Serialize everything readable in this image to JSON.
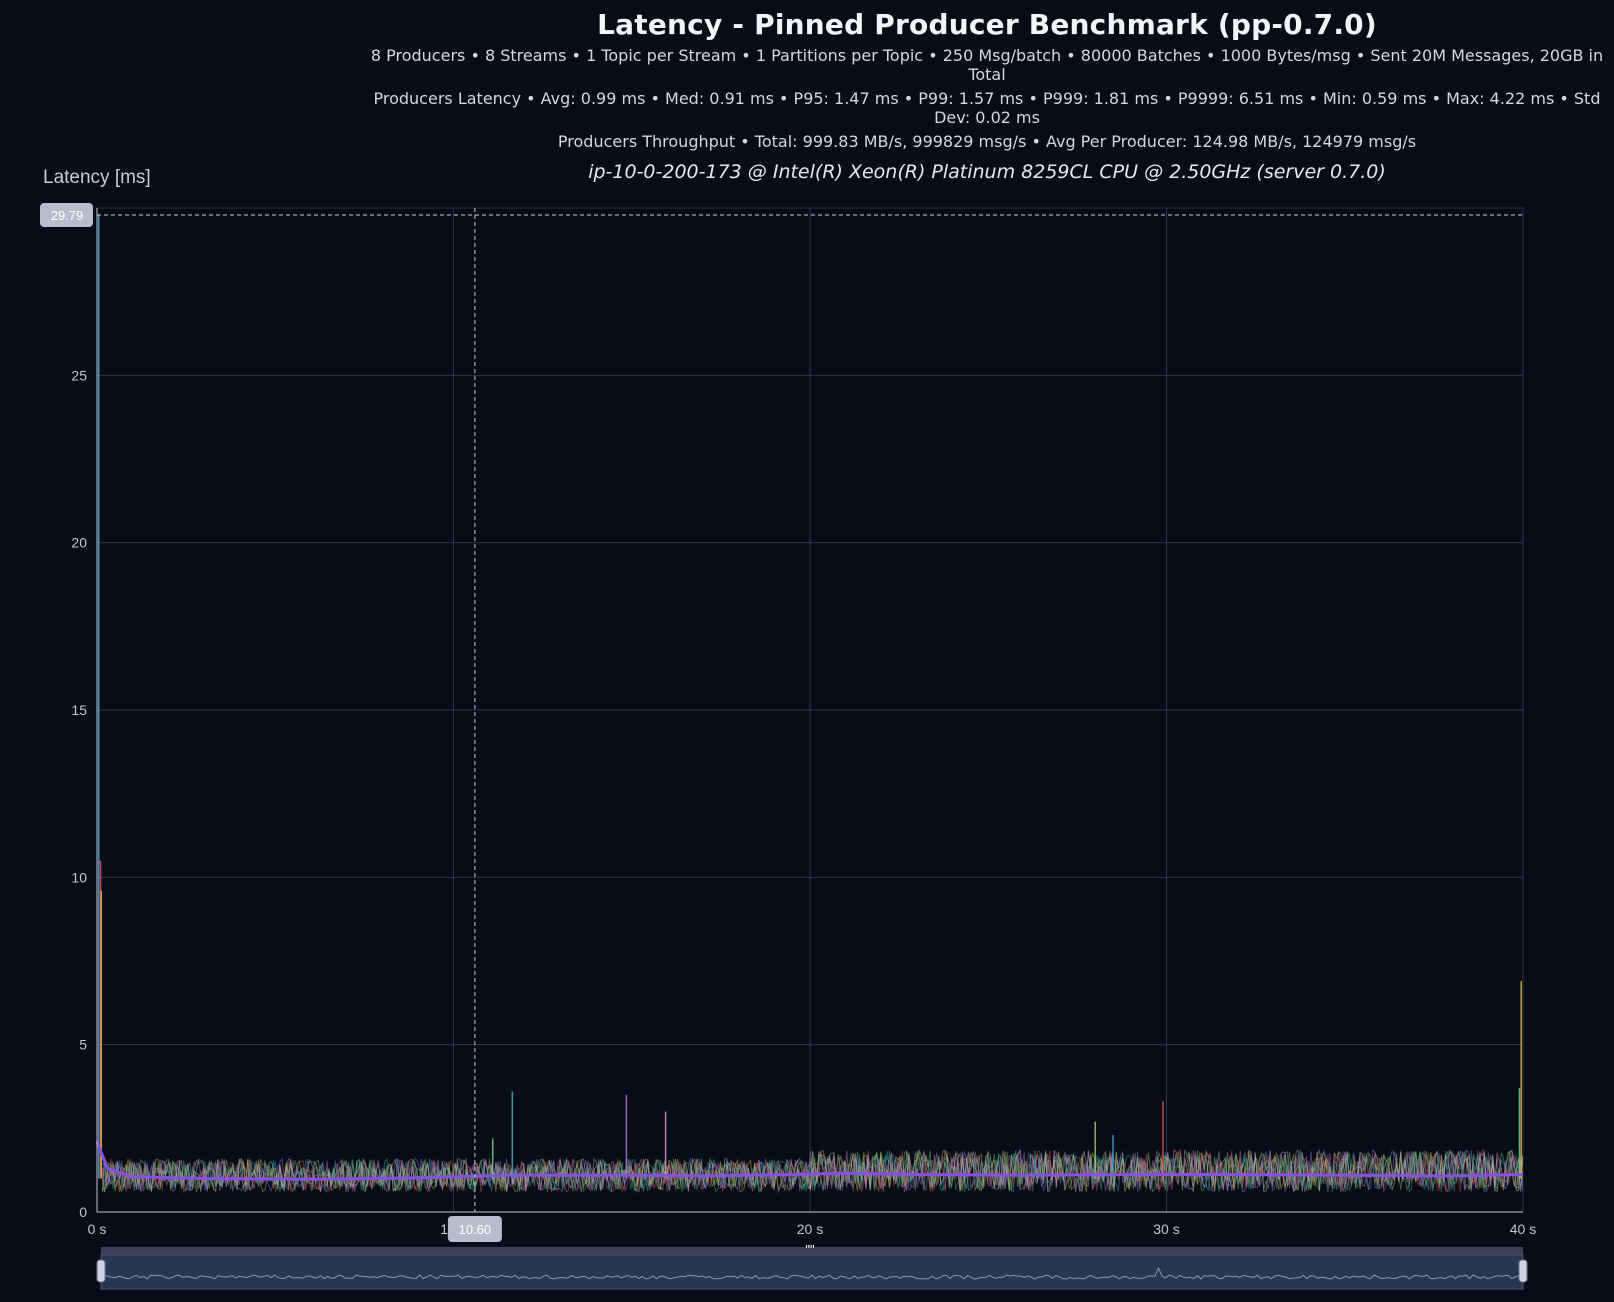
{
  "header": {
    "title": "Latency - Pinned Producer Benchmark (pp-0.7.0)",
    "line1": "8 Producers • 8 Streams • 1 Topic per Stream • 1 Partitions per Topic • 250 Msg/batch • 80000 Batches • 1000 Bytes/msg • Sent 20M Messages, 20GB in Total",
    "line2": "Producers Latency • Avg: 0.99 ms • Med: 0.91 ms • P95: 1.47 ms • P99: 1.57 ms • P999: 1.81 ms • P9999: 6.51 ms • Min: 0.59 ms • Max: 4.22 ms • Std Dev: 0.02 ms",
    "line3": "Producers Throughput • Total: 999.83 MB/s, 999829 msg/s • Avg Per Producer: 124.98 MB/s, 124979 msg/s",
    "host": "ip-10-0-200-173 @ Intel(R) Xeon(R) Platinum 8259CL CPU @ 2.50GHz (server 0.7.0)"
  },
  "chart_data": {
    "type": "line",
    "ylabel": "Latency [ms]",
    "xlim": [
      0,
      40
    ],
    "ylim": [
      0,
      30
    ],
    "x_ticks": [
      {
        "value": 0,
        "label": "0 s"
      },
      {
        "value": 10,
        "label": "10 s"
      },
      {
        "value": 20,
        "label": "20 s"
      },
      {
        "value": 30,
        "label": "30 s"
      },
      {
        "value": 40,
        "label": "40 s"
      }
    ],
    "y_ticks": [
      0,
      5,
      10,
      15,
      20,
      25
    ],
    "grid": true,
    "crosshair": {
      "x": 10.6,
      "y": 29.79,
      "x_label": "10.60",
      "y_label": "29.79"
    },
    "series_colors": [
      "#4fa3d9",
      "#d9574f",
      "#e6b84f",
      "#6fcf8f",
      "#3fb6b0",
      "#b27ad9",
      "#e08ac7",
      "#9ad06f"
    ],
    "average_color": "#8a4fe0",
    "producer_band": {
      "low": 0.6,
      "high": 1.6
    },
    "average_latency": [
      [
        0,
        2.1
      ],
      [
        0.3,
        1.3
      ],
      [
        1,
        1.05
      ],
      [
        3,
        1.0
      ],
      [
        6,
        0.98
      ],
      [
        9,
        1.02
      ],
      [
        11.5,
        1.1
      ],
      [
        14.8,
        1.1
      ],
      [
        17,
        1.08
      ],
      [
        19.5,
        1.12
      ],
      [
        21,
        1.16
      ],
      [
        23,
        1.12
      ],
      [
        26,
        1.1
      ],
      [
        29,
        1.12
      ],
      [
        32,
        1.12
      ],
      [
        35,
        1.1
      ],
      [
        38,
        1.08
      ],
      [
        40,
        1.12
      ]
    ],
    "spikes": [
      [
        0.05,
        29.79
      ],
      [
        0.1,
        10.5
      ],
      [
        0.12,
        9.6
      ],
      [
        11.1,
        2.2
      ],
      [
        11.65,
        3.6
      ],
      [
        14.85,
        3.5
      ],
      [
        15.95,
        3.0
      ],
      [
        28.0,
        2.7
      ],
      [
        28.5,
        2.3
      ],
      [
        29.9,
        3.3
      ],
      [
        39.95,
        6.9
      ],
      [
        39.9,
        3.7
      ]
    ]
  },
  "range_selector": {
    "handle_glyph": "\"\""
  }
}
